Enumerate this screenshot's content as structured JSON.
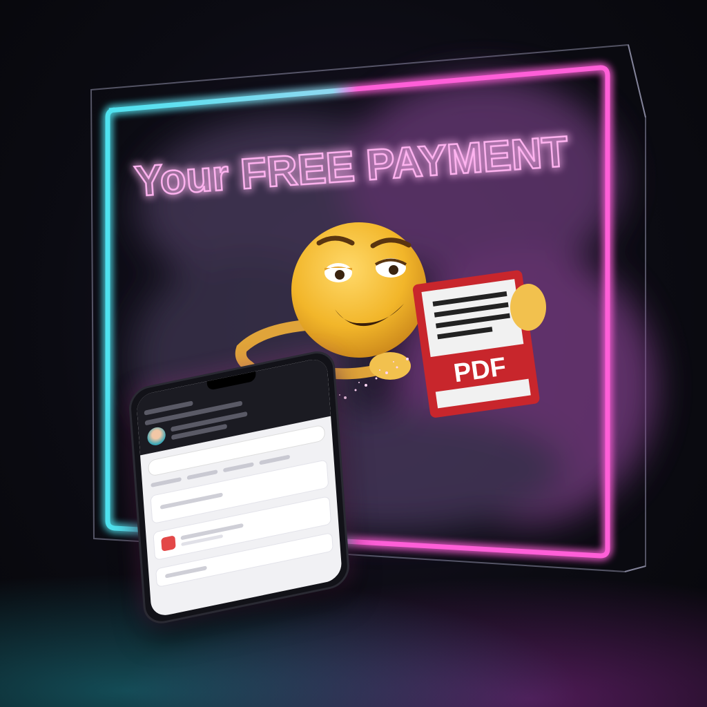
{
  "headline": {
    "text": "Your FREE PAYMENT"
  },
  "document": {
    "label": "PDF"
  },
  "colors": {
    "neon_pink": "#ff5fd8",
    "neon_cyan": "#4fe3f0",
    "pdf_red": "#c8262c",
    "emoji_yellow": "#f2b62a"
  },
  "icons": {
    "emoji": "smirking-face",
    "document": "pdf-document-icon"
  }
}
